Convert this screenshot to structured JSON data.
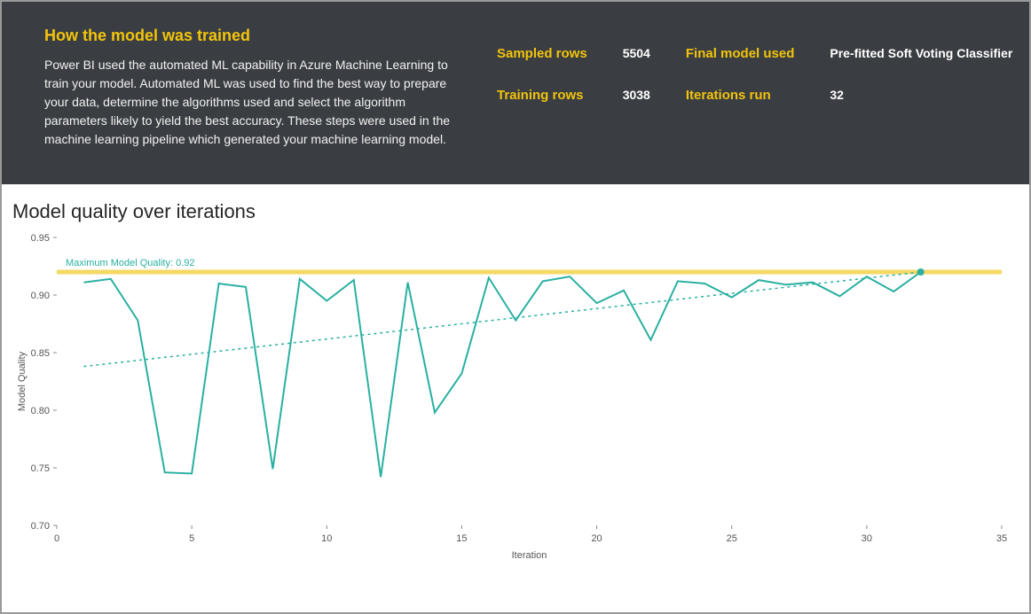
{
  "header": {
    "title": "How the model was trained",
    "description": "Power BI used the automated ML capability in Azure Machine Learning to train your model. Automated ML was used to find the best way to prepare your data, determine the algorithms used and select the algorithm parameters likely to yield the best accuracy. These steps were used in the machine learning pipeline which generated your machine learning model.",
    "metrics": {
      "sampled_rows_label": "Sampled rows",
      "sampled_rows_value": "5504",
      "final_model_label": "Final model used",
      "final_model_value": "Pre-fitted Soft Voting Classifier",
      "training_rows_label": "Training rows",
      "training_rows_value": "3038",
      "iterations_run_label": "Iterations run",
      "iterations_run_value": "32"
    }
  },
  "chart": {
    "title": "Model quality over iterations",
    "annotation": "Maximum Model Quality: 0.92",
    "xlabel": "Iteration",
    "ylabel": "Model Quality"
  },
  "chart_data": {
    "type": "line",
    "title": "Model quality over iterations",
    "xlabel": "Iteration",
    "ylabel": "Model Quality",
    "xlim": [
      0,
      35
    ],
    "ylim": [
      0.7,
      0.95
    ],
    "x_ticks": [
      0,
      5,
      10,
      15,
      20,
      25,
      30,
      35
    ],
    "y_ticks": [
      0.7,
      0.75,
      0.8,
      0.85,
      0.9,
      0.95
    ],
    "reference_line": {
      "label": "Maximum Model Quality: 0.92",
      "y": 0.92
    },
    "series": [
      {
        "name": "Model Quality",
        "style": "solid",
        "x": [
          1,
          2,
          3,
          4,
          5,
          6,
          7,
          8,
          9,
          10,
          11,
          12,
          13,
          14,
          15,
          16,
          17,
          18,
          19,
          20,
          21,
          22,
          23,
          24,
          25,
          26,
          27,
          28,
          29,
          30,
          31,
          32
        ],
        "y": [
          0.911,
          0.914,
          0.878,
          0.746,
          0.745,
          0.91,
          0.907,
          0.749,
          0.914,
          0.895,
          0.913,
          0.742,
          0.911,
          0.798,
          0.832,
          0.915,
          0.878,
          0.912,
          0.916,
          0.893,
          0.904,
          0.861,
          0.912,
          0.91,
          0.898,
          0.913,
          0.909,
          0.911,
          0.899,
          0.916,
          0.903,
          0.92
        ]
      },
      {
        "name": "Trend",
        "style": "dashed",
        "x": [
          1,
          32
        ],
        "y": [
          0.838,
          0.92
        ]
      }
    ]
  }
}
